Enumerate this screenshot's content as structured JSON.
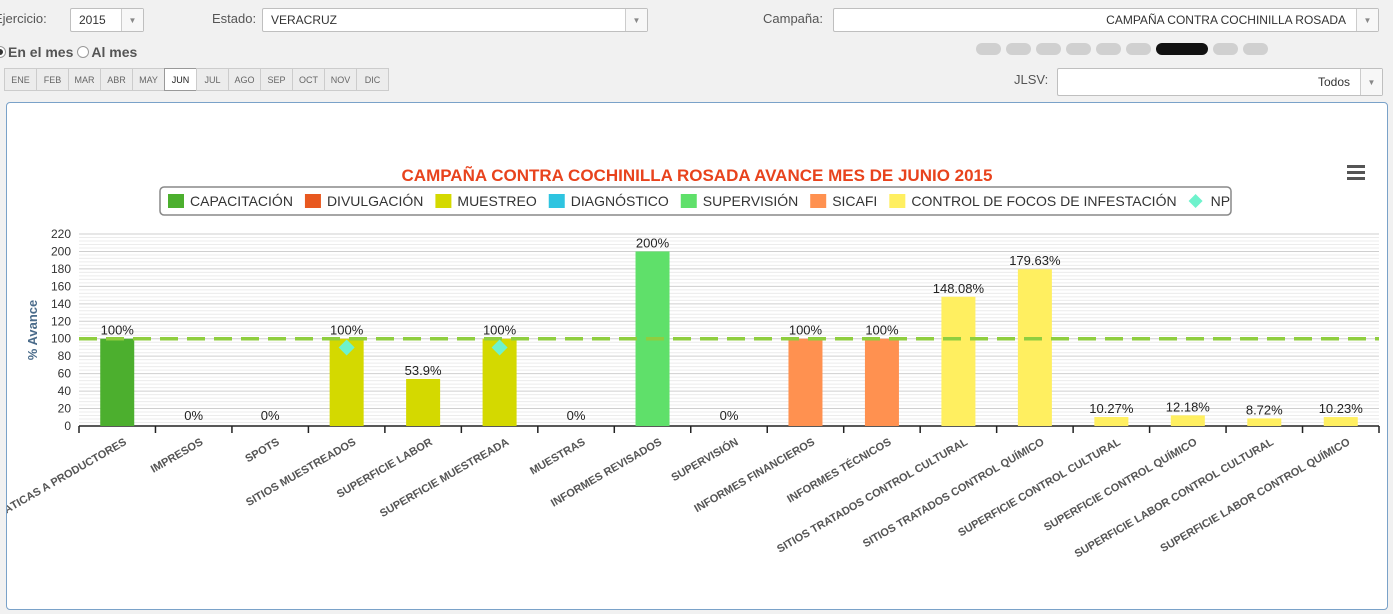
{
  "filters": {
    "ejercicio_label": "Ejercicio:",
    "ejercicio_value": "2015",
    "estado_label": "Estado:",
    "estado_value": "VERACRUZ",
    "campana_label": "Campaña:",
    "campana_value": "CAMPAÑA CONTRA COCHINILLA ROSADA",
    "jlsv_label": "JLSV:",
    "jlsv_value": "Todos",
    "radio_en_mes": "En el mes",
    "radio_al_mes": "Al mes",
    "months": [
      "ENE",
      "FEB",
      "MAR",
      "ABR",
      "MAY",
      "JUN",
      "JUL",
      "AGO",
      "SEP",
      "OCT",
      "NOV",
      "DIC"
    ],
    "active_month": "JUN"
  },
  "pager": {
    "count": 9,
    "active_index": 6
  },
  "chart_data": {
    "type": "bar",
    "title": "CAMPAÑA CONTRA COCHINILLA ROSADA AVANCE MES DE JUNIO 2015",
    "title_color": "#e8431d",
    "ylabel": "% Avance",
    "ylim": [
      0,
      220
    ],
    "yticks": [
      0,
      20,
      40,
      60,
      80,
      100,
      120,
      140,
      160,
      180,
      200,
      220
    ],
    "reference_line": {
      "value": 100,
      "color": "#8fce3f",
      "style": "dashed"
    },
    "legend": [
      {
        "name": "CAPACITACIÓN",
        "color": "#4caf2e",
        "shape": "square"
      },
      {
        "name": "DIVULGACIÓN",
        "color": "#e8581f",
        "shape": "square"
      },
      {
        "name": "MUESTREO",
        "color": "#d4d900",
        "shape": "square"
      },
      {
        "name": "DIAGNÓSTICO",
        "color": "#2ec4e0",
        "shape": "square"
      },
      {
        "name": "SUPERVISIÓN",
        "color": "#5fe06a",
        "shape": "square"
      },
      {
        "name": "SICAFI",
        "color": "#ff9150",
        "shape": "square"
      },
      {
        "name": "CONTROL DE FOCOS DE INFESTACIÓN",
        "color": "#ffef60",
        "shape": "square"
      },
      {
        "name": "NP",
        "color": "#6ef2cc",
        "shape": "diamond"
      }
    ],
    "categories": [
      "PLÁTICAS A PRODUCTORES",
      "IMPRESOS",
      "SPOTS",
      "SITIOS MUESTREADOS",
      "SUPERFICIE LABOR",
      "SUPERFICIE MUESTREADA",
      "MUESTRAS",
      "INFORMES REVISADOS",
      "SUPERVISIÓN",
      "INFORMES FINANCIEROS",
      "INFORMES TÉCNICOS",
      "SITIOS TRATADOS CONTROL CULTURAL",
      "SITIOS TRATADOS CONTROL QUÍMICO",
      "SUPERFICIE CONTROL CULTURAL",
      "SUPERFICIE CONTROL QUÍMICO",
      "SUPERFICIE LABOR CONTROL CULTURAL",
      "SUPERFICIE LABOR CONTROL QUÍMICO"
    ],
    "values": [
      100,
      0,
      0,
      100,
      53.9,
      100,
      0,
      200,
      0,
      100,
      100,
      148.08,
      179.63,
      10.27,
      12.18,
      8.72,
      10.23
    ],
    "labels": [
      "100%",
      "0%",
      "0%",
      "100%",
      "53.9%",
      "100%",
      "0%",
      "200%",
      "0%",
      "100%",
      "100%",
      "148.08%",
      "179.63%",
      "10.27%",
      "12.18%",
      "8.72%",
      "10.23%"
    ],
    "series_of": [
      "CAPACITACIÓN",
      "DIVULGACIÓN",
      "DIVULGACIÓN",
      "MUESTREO",
      "MUESTREO",
      "MUESTREO",
      "DIAGNÓSTICO",
      "SUPERVISIÓN",
      "SUPERVISIÓN",
      "SICAFI",
      "SICAFI",
      "CONTROL DE FOCOS DE INFESTACIÓN",
      "CONTROL DE FOCOS DE INFESTACIÓN",
      "CONTROL DE FOCOS DE INFESTACIÓN",
      "CONTROL DE FOCOS DE INFESTACIÓN",
      "CONTROL DE FOCOS DE INFESTACIÓN",
      "CONTROL DE FOCOS DE INFESTACIÓN"
    ],
    "np_points": [
      {
        "category": "SITIOS MUESTREADOS",
        "value": 90
      },
      {
        "category": "SUPERFICIE MUESTREADA",
        "value": 90
      }
    ]
  }
}
